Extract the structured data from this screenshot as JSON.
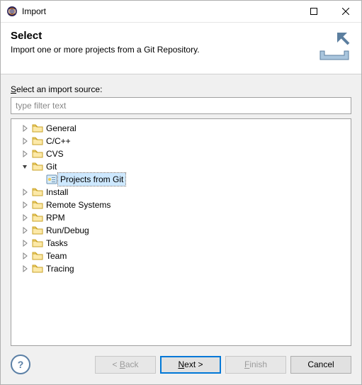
{
  "window": {
    "title": "Import"
  },
  "banner": {
    "title": "Select",
    "description": "Import one or more projects from a Git Repository."
  },
  "content": {
    "source_label_pre": "S",
    "source_label_rest": "elect an import source:",
    "filter_placeholder": "type filter text"
  },
  "tree": {
    "nodes": [
      {
        "label": "General",
        "expanded": false,
        "level": 1,
        "kind": "folder"
      },
      {
        "label": "C/C++",
        "expanded": false,
        "level": 1,
        "kind": "folder"
      },
      {
        "label": "CVS",
        "expanded": false,
        "level": 1,
        "kind": "folder"
      },
      {
        "label": "Git",
        "expanded": true,
        "level": 1,
        "kind": "folder"
      },
      {
        "label": "Projects from Git",
        "expanded": null,
        "level": 2,
        "kind": "wizard",
        "selected": true
      },
      {
        "label": "Install",
        "expanded": false,
        "level": 1,
        "kind": "folder"
      },
      {
        "label": "Remote Systems",
        "expanded": false,
        "level": 1,
        "kind": "folder"
      },
      {
        "label": "RPM",
        "expanded": false,
        "level": 1,
        "kind": "folder"
      },
      {
        "label": "Run/Debug",
        "expanded": false,
        "level": 1,
        "kind": "folder"
      },
      {
        "label": "Tasks",
        "expanded": false,
        "level": 1,
        "kind": "folder"
      },
      {
        "label": "Team",
        "expanded": false,
        "level": 1,
        "kind": "folder"
      },
      {
        "label": "Tracing",
        "expanded": false,
        "level": 1,
        "kind": "folder"
      }
    ]
  },
  "buttons": {
    "back_pre": "< ",
    "back_u": "B",
    "back_rest": "ack",
    "next_u": "N",
    "next_rest": "ext >",
    "finish_u": "F",
    "finish_rest": "inish",
    "cancel": "Cancel"
  }
}
